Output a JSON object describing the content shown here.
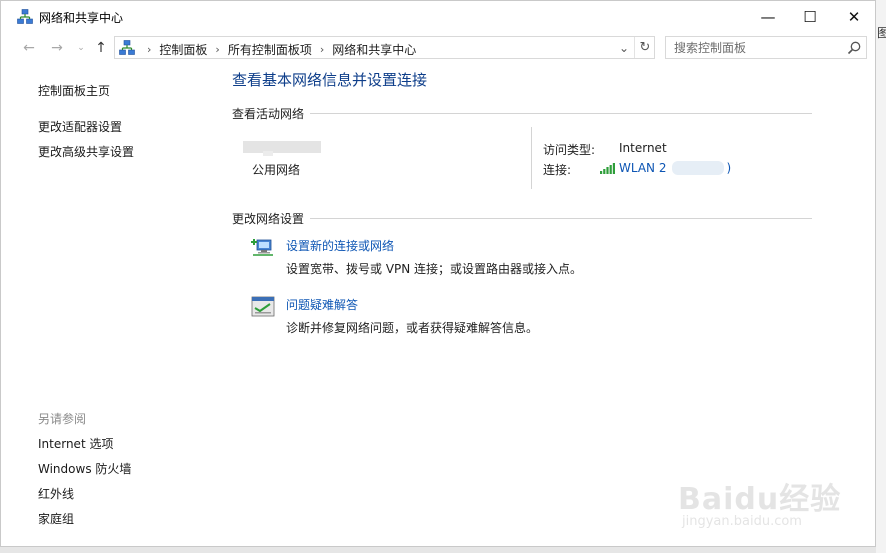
{
  "window": {
    "title": "网络和共享中心",
    "controls": {
      "minimize": "—",
      "maximize": "☐",
      "close": "✕"
    }
  },
  "nav": {
    "back": "←",
    "forward": "→",
    "recent": "⌄",
    "up": "↑",
    "breadcrumb": [
      "控制面板",
      "所有控制面板项",
      "网络和共享中心"
    ],
    "separator": "›",
    "dropdown": "⌄",
    "refresh": "↻"
  },
  "search": {
    "placeholder": "搜索控制面板"
  },
  "sidebar": {
    "links": [
      "控制面板主页",
      "更改适配器设置",
      "更改高级共享设置"
    ],
    "see_also_heading": "另请参阅",
    "see_also": [
      "Internet 选项",
      "Windows 防火墙",
      "红外线",
      "家庭组"
    ]
  },
  "main": {
    "title": "查看基本网络信息并设置连接",
    "active_networks_heading": "查看活动网络",
    "network": {
      "type": "公用网络",
      "access_type_label": "访问类型:",
      "access_type_value": "Internet",
      "connection_label": "连接:",
      "connection_link": "WLAN 2",
      "connection_suffix": ")"
    },
    "change_settings_heading": "更改网络设置",
    "tasks": [
      {
        "link": "设置新的连接或网络",
        "desc": "设置宽带、拨号或 VPN 连接；或设置路由器或接入点。",
        "icon": "new-connection-icon"
      },
      {
        "link": "问题疑难解答",
        "desc": "诊断并修复网络问题，或者获得疑难解答信息。",
        "icon": "troubleshoot-icon"
      }
    ]
  },
  "right_edge_glyph": "图",
  "watermark": {
    "brand": "Baidu经验",
    "url": "jingyan.baidu.com"
  },
  "colors": {
    "link": "#0e56b4",
    "title": "#0e3e8a",
    "muted": "#8a8a8a"
  }
}
